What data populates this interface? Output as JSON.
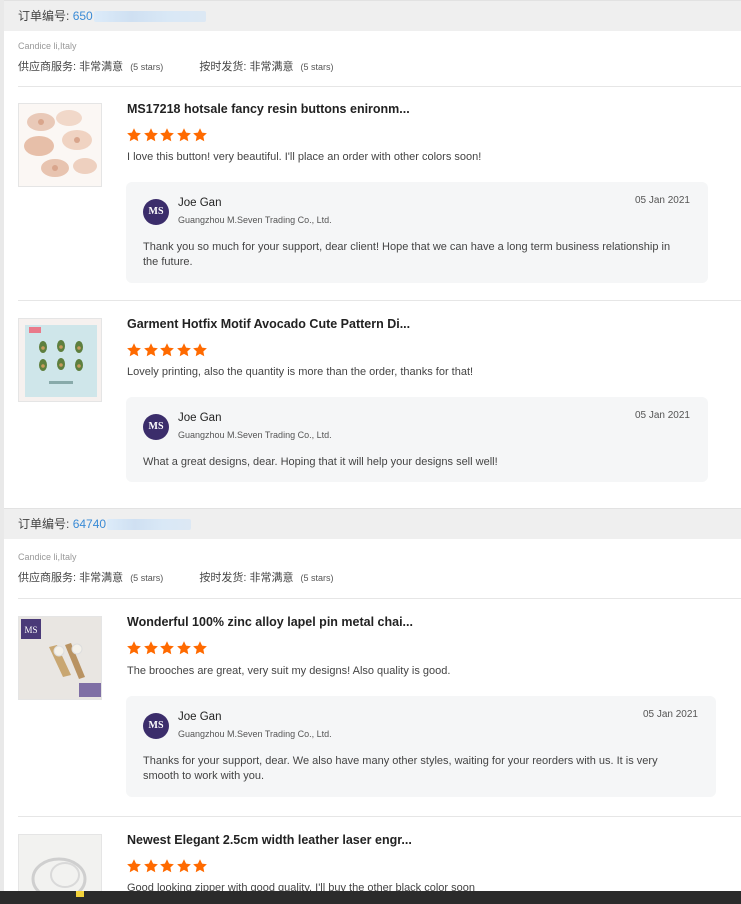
{
  "labels": {
    "order_number": "订单编号:",
    "supplier_service": "供应商服务:",
    "on_time_delivery": "按时发货:",
    "very_satisfied": "非常满意",
    "five_stars": "(5 stars)"
  },
  "colors": {
    "star": "#ff6a00",
    "link": "#3a8bd6",
    "avatar": "#3b2d6b"
  },
  "icons": {
    "star": "star-icon",
    "avatar_logo": "ms-logo-avatar"
  },
  "orders": [
    {
      "order_no": "650",
      "buyer": "Candice li,Italy",
      "items": [
        {
          "title": "MS17218 hotsale fancy resin buttons enironm...",
          "rating": 5,
          "comment": "I love this button! very beautiful. I'll place an order with other colors soon!",
          "reply": {
            "avatar_text": "MS",
            "name": "Joe Gan",
            "company": "Guangzhou M.Seven Trading Co., Ltd.",
            "date": "05 Jan 2021",
            "text": "Thank you so much for your support, dear client! Hope that we can have a long term business relationship in the future."
          }
        },
        {
          "title": "Garment Hotfix Motif Avocado Cute Pattern Di...",
          "rating": 5,
          "comment": "Lovely printing, also the quantity is more than the order, thanks for that!",
          "reply": {
            "avatar_text": "MS",
            "name": "Joe Gan",
            "company": "Guangzhou M.Seven Trading Co., Ltd.",
            "date": "05 Jan 2021",
            "text": "What a great designs, dear. Hoping that it will help your designs sell well!"
          }
        }
      ]
    },
    {
      "order_no": "64740",
      "buyer": "Candice li,Italy",
      "items": [
        {
          "title": "Wonderful 100% zinc alloy lapel pin metal chai...",
          "rating": 5,
          "comment": "The brooches are great, very suit my designs! Also quality is good.",
          "reply": {
            "avatar_text": "MS",
            "name": "Joe Gan",
            "company": "Guangzhou M.Seven Trading Co., Ltd.",
            "date": "05 Jan 2021",
            "text": "Thanks for your support, dear. We also have many other styles, waiting for your reorders with us. It is very smooth to work with you."
          }
        },
        {
          "title": "Newest Elegant 2.5cm width leather laser engr...",
          "rating": 5,
          "comment": "Good looking zipper with good quality. I'll buy the other black color soon"
        }
      ]
    }
  ]
}
